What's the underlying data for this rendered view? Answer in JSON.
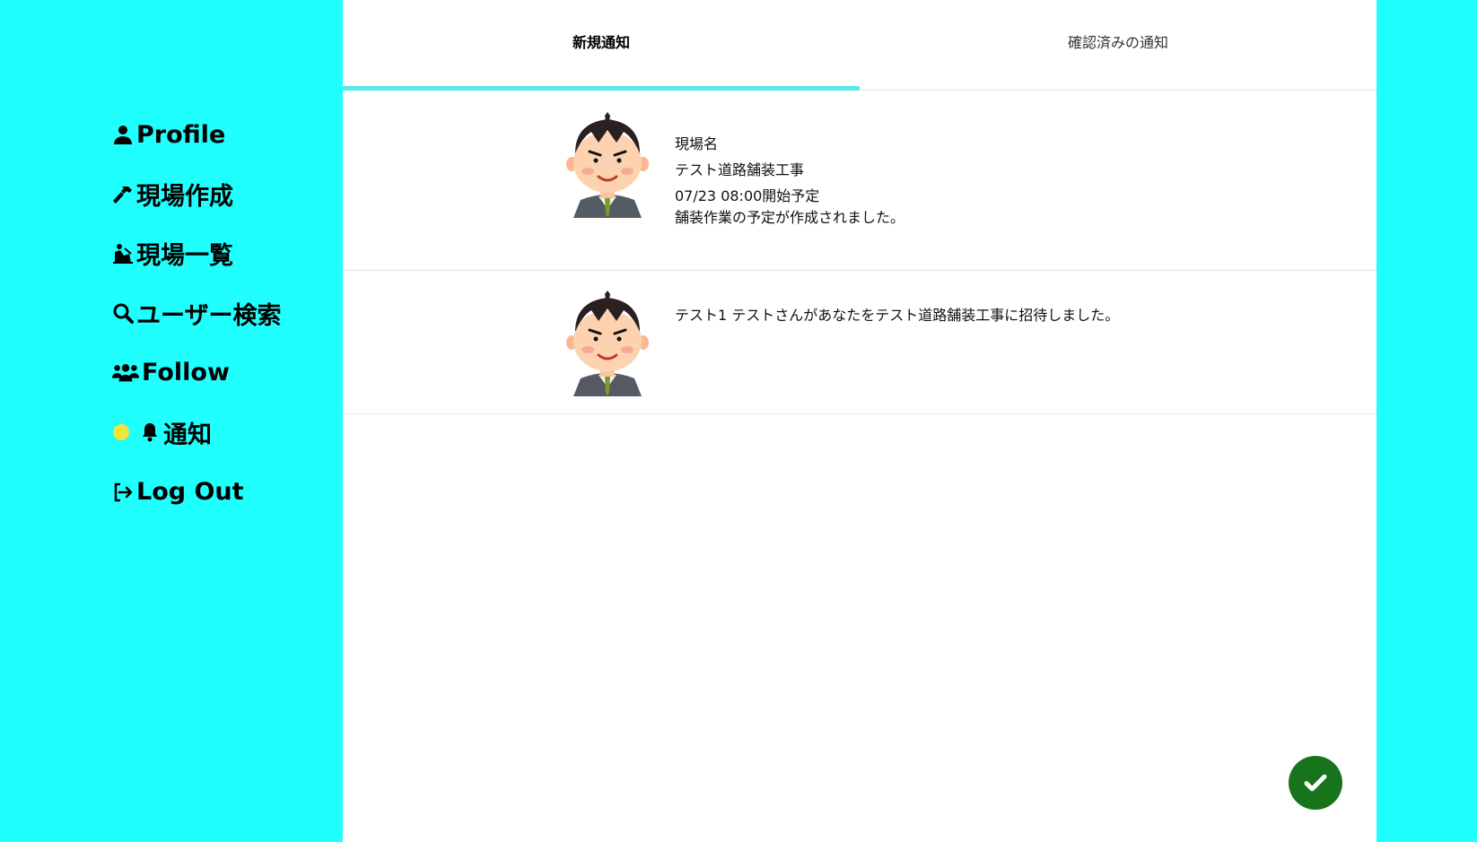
{
  "sidebar": {
    "items": [
      {
        "label": "Profile",
        "icon": "user-icon"
      },
      {
        "label": "現場作成",
        "icon": "hammer-icon"
      },
      {
        "label": "現場一覧",
        "icon": "worker-icon"
      },
      {
        "label": "ユーザー検索",
        "icon": "search-icon"
      },
      {
        "label": "Follow",
        "icon": "users-icon"
      },
      {
        "label": "通知",
        "icon": "bell-icon",
        "badge_color": "#f4e33a"
      },
      {
        "label": "Log Out",
        "icon": "logout-icon"
      }
    ]
  },
  "tabs": [
    {
      "label": "新規通知",
      "active": true
    },
    {
      "label": "確認済みの通知",
      "active": false
    }
  ],
  "notifications": [
    {
      "lines": [
        "現場名",
        "テスト道路舗装工事",
        "07/23 08:00開始予定",
        "舗装作業の予定が作成されました。"
      ]
    },
    {
      "lines": [
        "テスト1 テストさんがあなたをテスト道路舗装工事に招待しました。"
      ]
    }
  ],
  "confirm_button": {
    "icon": "check-icon",
    "color": "#18741c"
  },
  "colors": {
    "background": "#1ffffe",
    "tab_indicator": "#57e6ea"
  }
}
